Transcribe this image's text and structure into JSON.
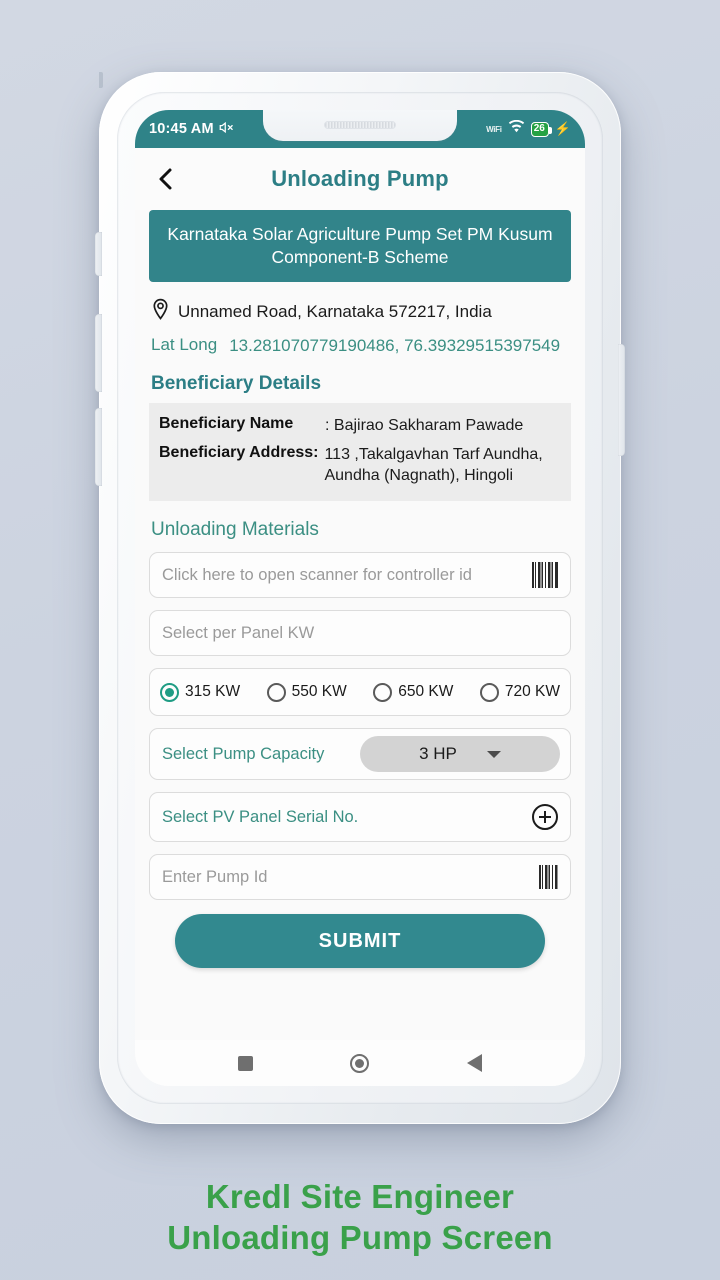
{
  "status_bar": {
    "time": "10:45 AM",
    "mute_icon": "mute-icon",
    "wifi_label": "WiFi",
    "wifi_icon": "wifi-icon",
    "battery_level": "26",
    "charging_icon": "charging-bolt-icon"
  },
  "appbar": {
    "back_icon": "back-chevron-icon",
    "title": "Unloading Pump"
  },
  "scheme": {
    "banner_text": "Karnataka Solar Agriculture Pump Set PM Kusum Component-B Scheme"
  },
  "location": {
    "pin_icon": "location-pin-icon",
    "address": "Unnamed Road, Karnataka 572217, India",
    "latlong_label": "Lat Long",
    "latlong_value": "13.281070779190486, 76.39329515397549"
  },
  "beneficiary": {
    "heading": "Beneficiary Details",
    "name_label": "Beneficiary Name",
    "name_value": ": Bajirao Sakharam Pawade",
    "address_label": "Beneficiary Address:",
    "address_value": "113 ,Takalgavhan Tarf Aundha, Aundha (Nagnath), Hingoli"
  },
  "materials": {
    "heading": "Unloading Materials",
    "controller_placeholder": "Click here to open scanner for controller id",
    "controller_icon": "barcode-scanner-icon",
    "panel_kw_placeholder": "Select per Panel KW",
    "panel_kw_options": [
      {
        "label": "315 KW",
        "selected": true
      },
      {
        "label": "550 KW",
        "selected": false
      },
      {
        "label": "650 KW",
        "selected": false
      },
      {
        "label": "720 KW",
        "selected": false
      }
    ],
    "pump_capacity_label": "Select Pump Capacity",
    "pump_capacity_value": "3 HP",
    "pump_capacity_caret": "chevron-down-icon",
    "pv_panel_placeholder": "Select PV Panel Serial No.",
    "pv_panel_add_icon": "plus-circle-icon",
    "pump_id_placeholder": "Enter Pump Id",
    "pump_id_icon": "barcode-scanner-icon"
  },
  "submit": {
    "label": "SUBMIT"
  },
  "nav": {
    "recents_icon": "square-recents-icon",
    "home_icon": "circle-home-icon",
    "back_icon": "triangle-back-icon"
  },
  "caption": {
    "line1": "Kredl Site Engineer",
    "line2": "Unloading Pump Screen"
  },
  "colors": {
    "teal": "#2f8388",
    "teal_banner": "#32848a",
    "teal_button": "#32898f",
    "teal_text": "#3b8f83",
    "radio_selected": "#1f9c84",
    "battery_green": "#25a244",
    "caption_green": "#3aa14a",
    "page_background": "#ccd3e0"
  }
}
